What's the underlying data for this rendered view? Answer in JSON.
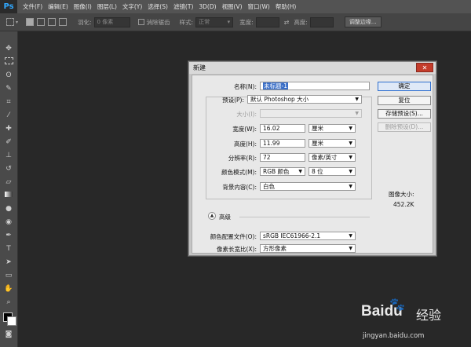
{
  "app": {
    "logo": "Ps"
  },
  "menubar": {
    "items": [
      "文件(F)",
      "编辑(E)",
      "图像(I)",
      "图层(L)",
      "文字(Y)",
      "选择(S)",
      "滤镜(T)",
      "3D(D)",
      "视图(V)",
      "窗口(W)",
      "帮助(H)"
    ]
  },
  "options": {
    "feather_label": "羽化:",
    "feather_value": "0 像素",
    "antialias_label": "消除锯齿",
    "style_label": "样式:",
    "style_value": "正常",
    "width_label": "宽度:",
    "height_label": "高度:",
    "refine_button": "调整边缘..."
  },
  "dialog": {
    "title": "新建",
    "name_label": "名称(N):",
    "name_value": "未标题-1",
    "preset_label": "预设(P):",
    "preset_value": "默认 Photoshop 大小",
    "size_label": "大小(I):",
    "width_label": "宽度(W):",
    "width_value": "16.02",
    "width_unit": "厘米",
    "height_label": "高度(H):",
    "height_value": "11.99",
    "height_unit": "厘米",
    "resolution_label": "分辨率(R):",
    "resolution_value": "72",
    "resolution_unit": "像素/英寸",
    "color_mode_label": "颜色模式(M):",
    "color_mode_value": "RGB 颜色",
    "bit_depth_value": "8 位",
    "bg_label": "背景内容(C):",
    "bg_value": "白色",
    "advanced_label": "高级",
    "color_profile_label": "颜色配置文件(O):",
    "color_profile_value": "sRGB IEC61966-2.1",
    "pixel_aspect_label": "像素长宽比(X):",
    "pixel_aspect_value": "方形像素",
    "ok_button": "确定",
    "reset_button": "复位",
    "save_preset_button": "存储预设(S)...",
    "delete_preset_button": "删除预设(D)...",
    "image_size_label": "图像大小:",
    "image_size_value": "452.2K",
    "close_glyph": "✕"
  },
  "watermark": {
    "brand": "Baidu",
    "brand_cn": "经验",
    "url": "jingyan.baidu.com"
  },
  "colors": {
    "accent": "#31a8ff",
    "selection": "#3b6fc7",
    "close": "#c43c2b"
  }
}
